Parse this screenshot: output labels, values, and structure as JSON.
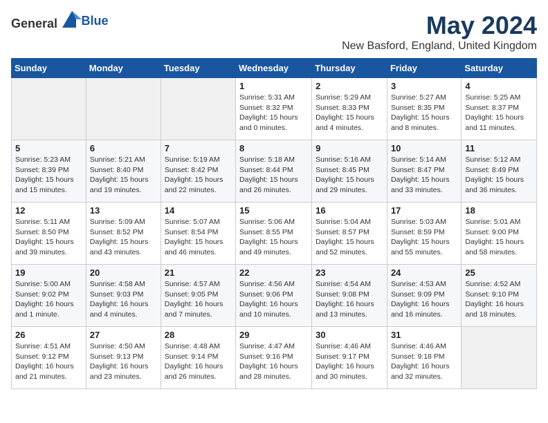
{
  "logo": {
    "text_general": "General",
    "text_blue": "Blue"
  },
  "title": "May 2024",
  "subtitle": "New Basford, England, United Kingdom",
  "days_of_week": [
    "Sunday",
    "Monday",
    "Tuesday",
    "Wednesday",
    "Thursday",
    "Friday",
    "Saturday"
  ],
  "weeks": [
    [
      {
        "day": "",
        "empty": true
      },
      {
        "day": "",
        "empty": true
      },
      {
        "day": "",
        "empty": true
      },
      {
        "day": "1",
        "sunrise": "5:31 AM",
        "sunset": "8:32 PM",
        "daylight": "15 hours and 0 minutes."
      },
      {
        "day": "2",
        "sunrise": "5:29 AM",
        "sunset": "8:33 PM",
        "daylight": "15 hours and 4 minutes."
      },
      {
        "day": "3",
        "sunrise": "5:27 AM",
        "sunset": "8:35 PM",
        "daylight": "15 hours and 8 minutes."
      },
      {
        "day": "4",
        "sunrise": "5:25 AM",
        "sunset": "8:37 PM",
        "daylight": "15 hours and 11 minutes."
      }
    ],
    [
      {
        "day": "5",
        "sunrise": "5:23 AM",
        "sunset": "8:39 PM",
        "daylight": "15 hours and 15 minutes."
      },
      {
        "day": "6",
        "sunrise": "5:21 AM",
        "sunset": "8:40 PM",
        "daylight": "15 hours and 19 minutes."
      },
      {
        "day": "7",
        "sunrise": "5:19 AM",
        "sunset": "8:42 PM",
        "daylight": "15 hours and 22 minutes."
      },
      {
        "day": "8",
        "sunrise": "5:18 AM",
        "sunset": "8:44 PM",
        "daylight": "15 hours and 26 minutes."
      },
      {
        "day": "9",
        "sunrise": "5:16 AM",
        "sunset": "8:45 PM",
        "daylight": "15 hours and 29 minutes."
      },
      {
        "day": "10",
        "sunrise": "5:14 AM",
        "sunset": "8:47 PM",
        "daylight": "15 hours and 33 minutes."
      },
      {
        "day": "11",
        "sunrise": "5:12 AM",
        "sunset": "8:49 PM",
        "daylight": "15 hours and 36 minutes."
      }
    ],
    [
      {
        "day": "12",
        "sunrise": "5:11 AM",
        "sunset": "8:50 PM",
        "daylight": "15 hours and 39 minutes."
      },
      {
        "day": "13",
        "sunrise": "5:09 AM",
        "sunset": "8:52 PM",
        "daylight": "15 hours and 43 minutes."
      },
      {
        "day": "14",
        "sunrise": "5:07 AM",
        "sunset": "8:54 PM",
        "daylight": "15 hours and 46 minutes."
      },
      {
        "day": "15",
        "sunrise": "5:06 AM",
        "sunset": "8:55 PM",
        "daylight": "15 hours and 49 minutes."
      },
      {
        "day": "16",
        "sunrise": "5:04 AM",
        "sunset": "8:57 PM",
        "daylight": "15 hours and 52 minutes."
      },
      {
        "day": "17",
        "sunrise": "5:03 AM",
        "sunset": "8:59 PM",
        "daylight": "15 hours and 55 minutes."
      },
      {
        "day": "18",
        "sunrise": "5:01 AM",
        "sunset": "9:00 PM",
        "daylight": "15 hours and 58 minutes."
      }
    ],
    [
      {
        "day": "19",
        "sunrise": "5:00 AM",
        "sunset": "9:02 PM",
        "daylight": "16 hours and 1 minute."
      },
      {
        "day": "20",
        "sunrise": "4:58 AM",
        "sunset": "9:03 PM",
        "daylight": "16 hours and 4 minutes."
      },
      {
        "day": "21",
        "sunrise": "4:57 AM",
        "sunset": "9:05 PM",
        "daylight": "16 hours and 7 minutes."
      },
      {
        "day": "22",
        "sunrise": "4:56 AM",
        "sunset": "9:06 PM",
        "daylight": "16 hours and 10 minutes."
      },
      {
        "day": "23",
        "sunrise": "4:54 AM",
        "sunset": "9:08 PM",
        "daylight": "16 hours and 13 minutes."
      },
      {
        "day": "24",
        "sunrise": "4:53 AM",
        "sunset": "9:09 PM",
        "daylight": "16 hours and 16 minutes."
      },
      {
        "day": "25",
        "sunrise": "4:52 AM",
        "sunset": "9:10 PM",
        "daylight": "16 hours and 18 minutes."
      }
    ],
    [
      {
        "day": "26",
        "sunrise": "4:51 AM",
        "sunset": "9:12 PM",
        "daylight": "16 hours and 21 minutes."
      },
      {
        "day": "27",
        "sunrise": "4:50 AM",
        "sunset": "9:13 PM",
        "daylight": "16 hours and 23 minutes."
      },
      {
        "day": "28",
        "sunrise": "4:48 AM",
        "sunset": "9:14 PM",
        "daylight": "16 hours and 26 minutes."
      },
      {
        "day": "29",
        "sunrise": "4:47 AM",
        "sunset": "9:16 PM",
        "daylight": "16 hours and 28 minutes."
      },
      {
        "day": "30",
        "sunrise": "4:46 AM",
        "sunset": "9:17 PM",
        "daylight": "16 hours and 30 minutes."
      },
      {
        "day": "31",
        "sunrise": "4:46 AM",
        "sunset": "9:18 PM",
        "daylight": "16 hours and 32 minutes."
      },
      {
        "day": "",
        "empty": true
      }
    ]
  ]
}
